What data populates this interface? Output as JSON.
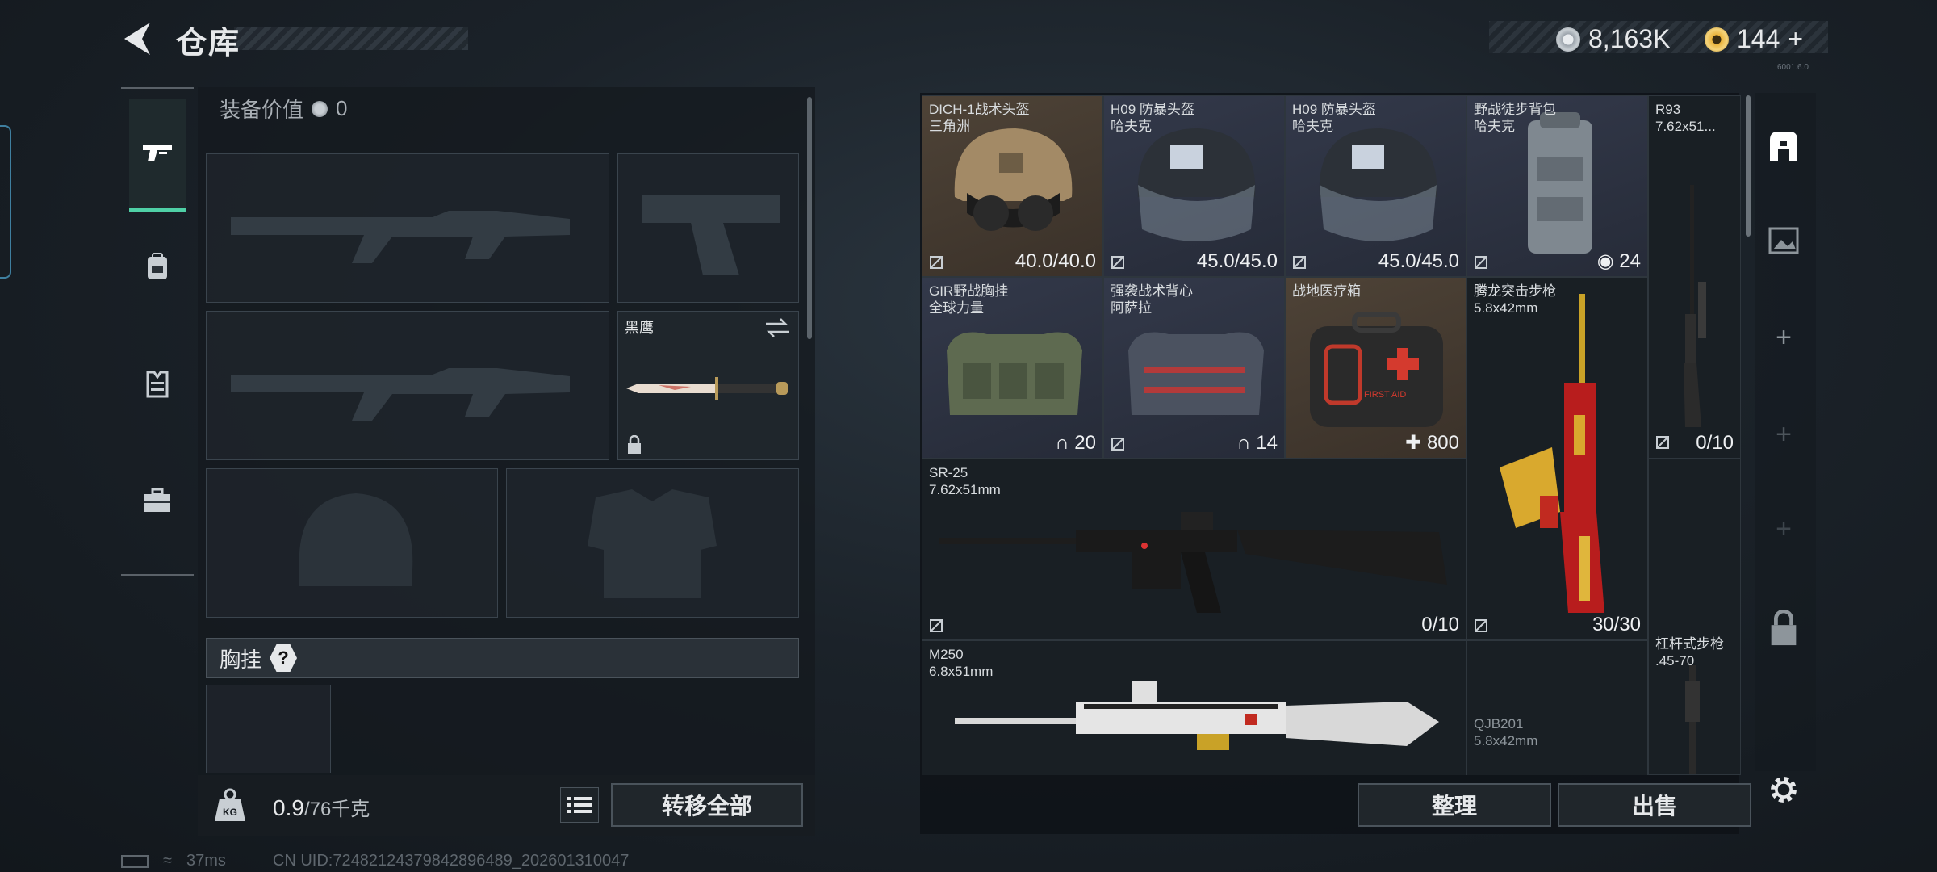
{
  "header": {
    "title": "仓库",
    "currency_coin": "8,163K",
    "currency_premium": "144",
    "premium_add": "+",
    "version": "6001.6.0"
  },
  "equipment": {
    "value_label": "装备价值",
    "value": "0",
    "knife_name": "黑鹰",
    "section_label": "胸挂",
    "help_label": "?"
  },
  "bottom": {
    "weight": "0.9",
    "weight_max": "/76千克",
    "weight_icon_label": "KG",
    "transfer_all": "转移全部",
    "organize": "整理",
    "sell": "出售"
  },
  "inventory": [
    {
      "name": "DICH-1战术头盔",
      "sub": "三角洲",
      "value": "40.0/40.0"
    },
    {
      "name": "H09 防暴头盔",
      "sub": "哈夫克",
      "value": "45.0/45.0"
    },
    {
      "name": "H09 防暴头盔",
      "sub": "哈夫克",
      "value": "45.0/45.0"
    },
    {
      "name": "野战徒步背包",
      "sub": "哈夫克",
      "value": "24"
    },
    {
      "name": "R93",
      "sub": "7.62x51...",
      "value": "0/10"
    },
    {
      "name": "GIR野战胸挂",
      "sub": "全球力量",
      "value": "20"
    },
    {
      "name": "强袭战术背心",
      "sub": "阿萨拉",
      "value": "14"
    },
    {
      "name": "战地医疗箱",
      "sub": "",
      "value": "800",
      "icon_text": "FIRST AID"
    },
    {
      "name": "腾龙突击步枪",
      "sub": "5.8x42mm",
      "value": "30/30"
    },
    {
      "name": "SR-25",
      "sub": "7.62x51mm",
      "value": "0/10"
    },
    {
      "name": "杠杆式步枪",
      "sub": ".45-70",
      "value": ""
    },
    {
      "name": "M250",
      "sub": "6.8x51mm",
      "value": ""
    },
    {
      "name": "QJB201",
      "sub": "5.8x42mm",
      "value": ""
    }
  ],
  "status": {
    "ping": "37ms",
    "uid": "CN UID:7248212437984289​6489_202601310047"
  },
  "colors": {
    "accent": "#4fd0a6",
    "brown_cell": "#4e4337",
    "blue_cell": "#33394a"
  },
  "icons": [
    "back-arrow-icon",
    "coin-icon",
    "premium-coin-icon",
    "gun-icon",
    "backpack-icon",
    "vest-icon",
    "toolbox-icon",
    "lock-icon",
    "swap-icon",
    "kg-weight-icon",
    "list-icon",
    "settings-icon",
    "safe-box-icon",
    "gallery-icon",
    "plus-icon"
  ]
}
